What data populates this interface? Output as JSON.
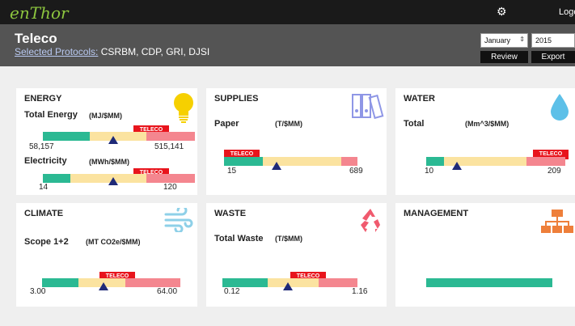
{
  "topbar": {
    "logo": "enThor",
    "logout": "Logout"
  },
  "header": {
    "company": "Teleco",
    "protocols_label": "Selected Protocols:",
    "protocols_value": "CSRBM, CDP, GRI, DJSI",
    "month": "January",
    "year": "2015",
    "review": "Review",
    "export": "Export"
  },
  "tag": "TELECO",
  "cards": {
    "energy": {
      "title": "ENERGY",
      "m1_label": "Total Energy",
      "m1_unit": "(MJ/$MM)",
      "m1_min": "58,157",
      "m1_max": "515,141",
      "m2_label": "Electricity",
      "m2_unit": "(MWh/$MM)",
      "m2_min": "14",
      "m2_max": "120"
    },
    "supplies": {
      "title": "SUPPLIES",
      "m_label": "Paper",
      "m_unit": "(T/$MM)",
      "min": "15",
      "max": "689"
    },
    "water": {
      "title": "WATER",
      "m_label": "Total",
      "m_unit": "(Mm^3/$MM)",
      "min": "10",
      "max": "209"
    },
    "climate": {
      "title": "CLIMATE",
      "m_label": "Scope 1+2",
      "m_unit": "(MT CO2e/$MM)",
      "min": "3.00",
      "max": "64.00"
    },
    "waste": {
      "title": "WASTE",
      "m_label": "Total Waste",
      "m_unit": "(T/$MM)",
      "min": "0.12",
      "max": "1.16"
    },
    "management": {
      "title": "MANAGEMENT"
    }
  },
  "icons": [
    "lightbulb-icon",
    "binders-icon",
    "water-drop-icon",
    "wind-icon",
    "recycle-icon",
    "org-chart-icon",
    "gear-icon"
  ],
  "colors": {
    "good": "#2bb993",
    "mid": "#fbe3a0",
    "bad": "#f4868f",
    "tag": "#e8141c",
    "marker": "#1f2a78"
  }
}
